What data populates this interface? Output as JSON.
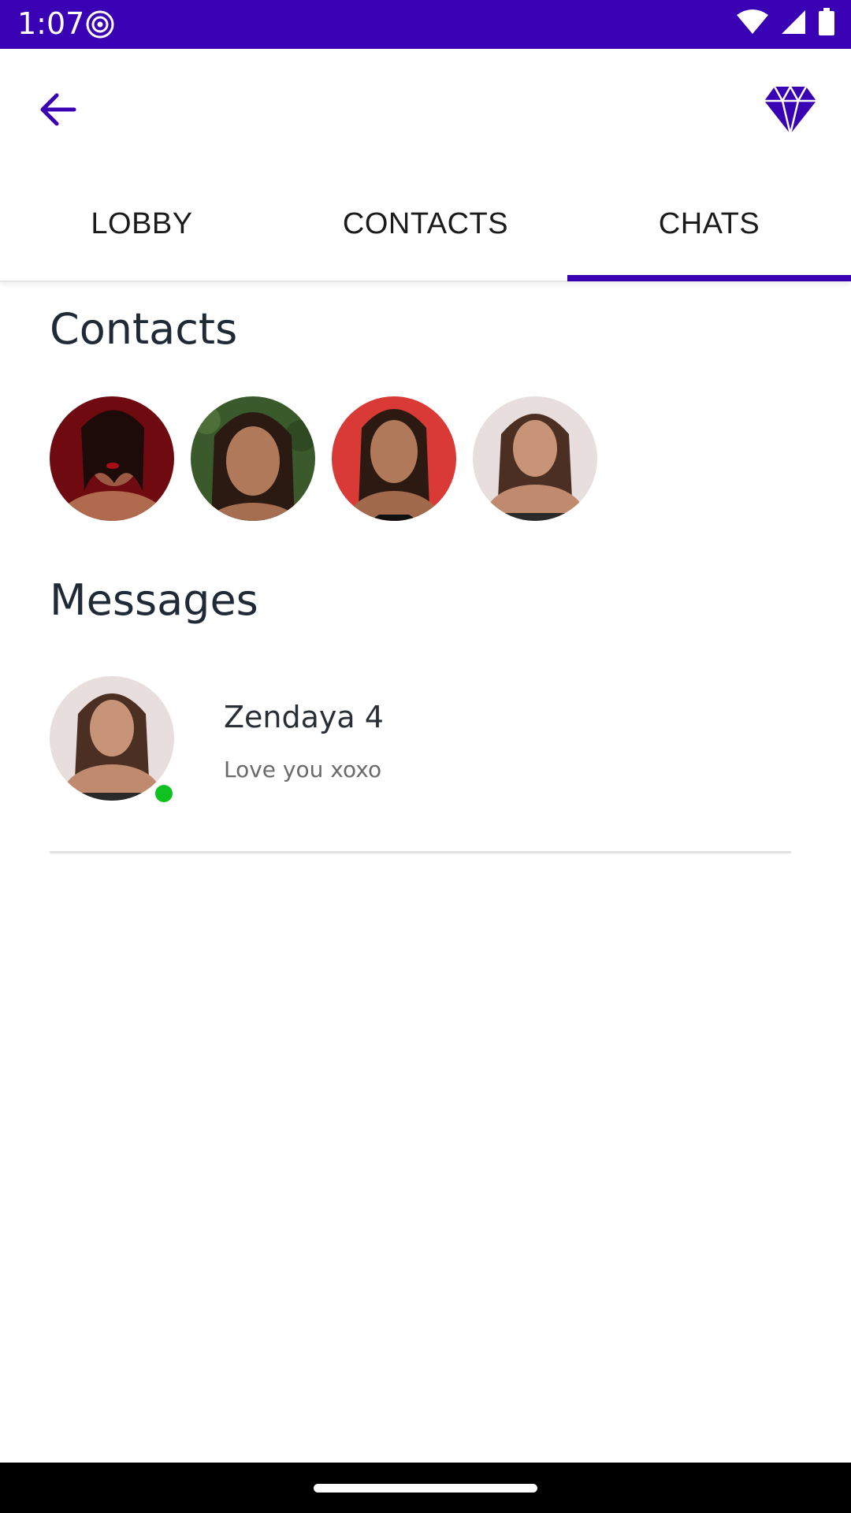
{
  "status_bar": {
    "time": "1:07",
    "icons": [
      "radio-icon",
      "wifi-icon",
      "signal-icon",
      "battery-icon"
    ],
    "background": "#3a00b4"
  },
  "appbar": {
    "back_icon": "arrow-left-icon",
    "premium_icon": "diamond-icon",
    "accent": "#3a00b4"
  },
  "tabs": [
    {
      "label": "LOBBY",
      "selected": false
    },
    {
      "label": "CONTACTS",
      "selected": false
    },
    {
      "label": "CHATS",
      "selected": true
    }
  ],
  "contacts_section": {
    "title": "Contacts",
    "avatars": [
      {
        "bg": "#7a0d12"
      },
      {
        "bg": "#3c5a2c"
      },
      {
        "bg": "#d9302e"
      },
      {
        "bg": "#e6dcdc"
      }
    ]
  },
  "messages_section": {
    "title": "Messages",
    "items": [
      {
        "name": "Zendaya 4",
        "preview": "Love you xoxo",
        "online": true,
        "online_color": "#10c221"
      }
    ]
  }
}
